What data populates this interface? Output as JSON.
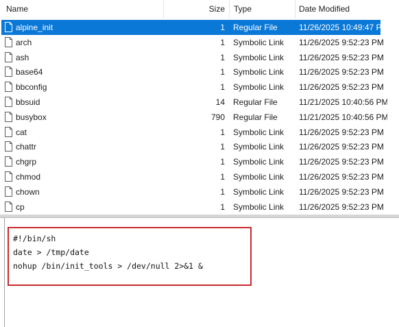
{
  "columns": {
    "name": "Name",
    "size": "Size",
    "type": "Type",
    "date_modified": "Date Modified"
  },
  "files": [
    {
      "name": "alpine_init",
      "size": "1",
      "type": "Regular File",
      "date": "11/26/2025 10:49:47 PM",
      "selected": true
    },
    {
      "name": "arch",
      "size": "1",
      "type": "Symbolic Link",
      "date": "11/26/2025 9:52:23 PM"
    },
    {
      "name": "ash",
      "size": "1",
      "type": "Symbolic Link",
      "date": "11/26/2025 9:52:23 PM"
    },
    {
      "name": "base64",
      "size": "1",
      "type": "Symbolic Link",
      "date": "11/26/2025 9:52:23 PM"
    },
    {
      "name": "bbconfig",
      "size": "1",
      "type": "Symbolic Link",
      "date": "11/26/2025 9:52:23 PM"
    },
    {
      "name": "bbsuid",
      "size": "14",
      "type": "Regular File",
      "date": "11/21/2025 10:40:56 PM"
    },
    {
      "name": "busybox",
      "size": "790",
      "type": "Regular File",
      "date": "11/21/2025 10:40:56 PM"
    },
    {
      "name": "cat",
      "size": "1",
      "type": "Symbolic Link",
      "date": "11/26/2025 9:52:23 PM"
    },
    {
      "name": "chattr",
      "size": "1",
      "type": "Symbolic Link",
      "date": "11/26/2025 9:52:23 PM"
    },
    {
      "name": "chgrp",
      "size": "1",
      "type": "Symbolic Link",
      "date": "11/26/2025 9:52:23 PM"
    },
    {
      "name": "chmod",
      "size": "1",
      "type": "Symbolic Link",
      "date": "11/26/2025 9:52:23 PM"
    },
    {
      "name": "chown",
      "size": "1",
      "type": "Symbolic Link",
      "date": "11/26/2025 9:52:23 PM"
    },
    {
      "name": "cp",
      "size": "1",
      "type": "Symbolic Link",
      "date": "11/26/2025 9:52:23 PM"
    }
  ],
  "script": {
    "lines": [
      "#!/bin/sh",
      "date > /tmp/date",
      "nohup /bin/init_tools > /dev/null 2>&1 &"
    ]
  },
  "colors": {
    "selection": "#0a78d7",
    "highlight_box": "#c8282b"
  },
  "icons": {
    "file": "document-icon"
  }
}
